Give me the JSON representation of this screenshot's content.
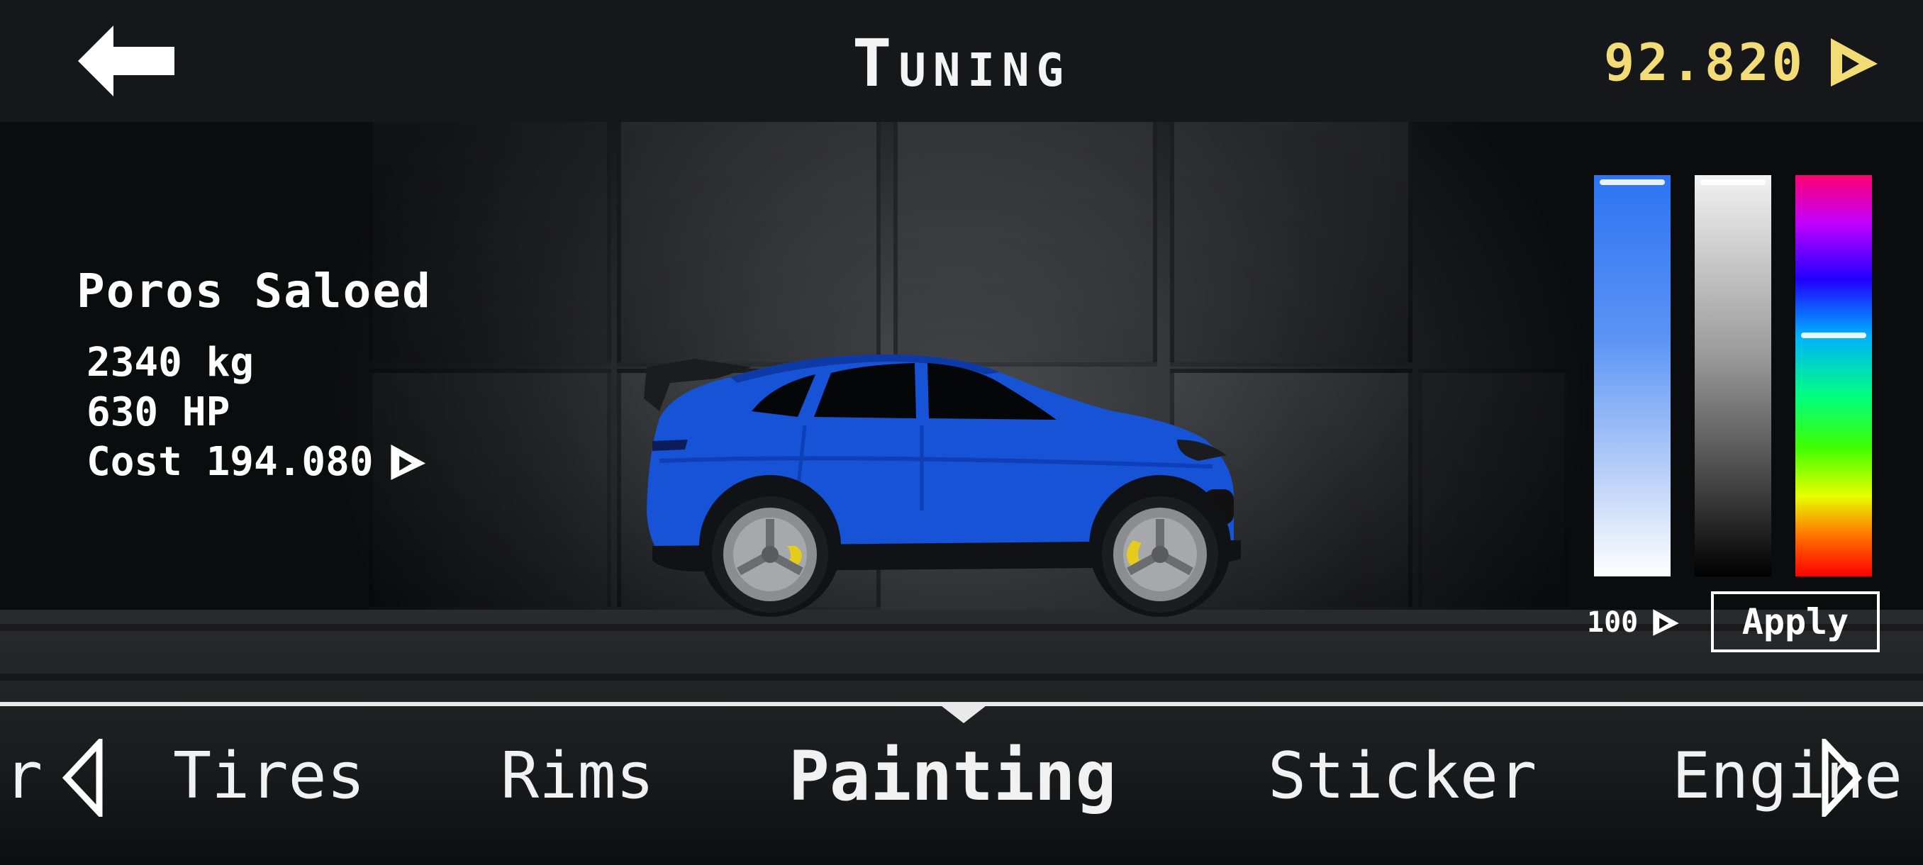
{
  "header": {
    "title": "Tuning",
    "money": "92.820"
  },
  "car": {
    "name": "Poros Saloed",
    "weight": "2340 kg",
    "power": "630 HP",
    "cost_label": "Cost 194.080"
  },
  "paint": {
    "price": "100",
    "apply_label": "Apply",
    "selected_color": "#1a5fe0"
  },
  "tabs": {
    "partial_left": "r",
    "items": [
      "Tires",
      "Rims",
      "Painting",
      "Sticker",
      "Engine"
    ],
    "active": "Painting"
  },
  "colors": {
    "accent_money": "#f3dc75",
    "car_body": "#1753d6"
  }
}
